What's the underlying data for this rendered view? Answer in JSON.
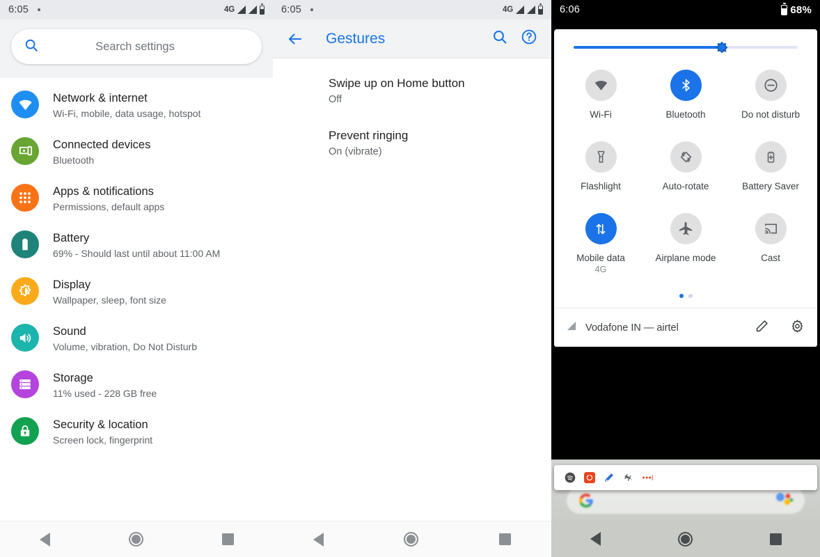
{
  "settings_screen": {
    "status_bar": {
      "time": "6:05",
      "network": "4G"
    },
    "search": {
      "placeholder": "Search settings"
    },
    "items": [
      {
        "title": "Network & internet",
        "subtitle": "Wi-Fi, mobile, data usage, hotspot",
        "icon": "wifi-icon",
        "color": "#1f8ef1"
      },
      {
        "title": "Connected devices",
        "subtitle": "Bluetooth",
        "icon": "connected-devices-icon",
        "color": "#68a532"
      },
      {
        "title": "Apps & notifications",
        "subtitle": "Permissions, default apps",
        "icon": "apps-grid-icon",
        "color": "#f97316"
      },
      {
        "title": "Battery",
        "subtitle": "69% - Should last until about 11:00 AM",
        "icon": "battery-icon",
        "color": "#1e8378"
      },
      {
        "title": "Display",
        "subtitle": "Wallpaper, sleep, font size",
        "icon": "brightness-icon",
        "color": "#fbab1a"
      },
      {
        "title": "Sound",
        "subtitle": "Volume, vibration, Do Not Disturb",
        "icon": "volume-icon",
        "color": "#1cb5ad"
      },
      {
        "title": "Storage",
        "subtitle": "11% used - 228 GB free",
        "icon": "storage-icon",
        "color": "#b444dd"
      },
      {
        "title": "Security & location",
        "subtitle": "Screen lock, fingerprint",
        "icon": "lock-icon",
        "color": "#12a150"
      }
    ]
  },
  "gestures_screen": {
    "status_bar": {
      "time": "6:05",
      "network": "4G"
    },
    "header": {
      "title": "Gestures",
      "accent_color": "#1a73e8"
    },
    "items": [
      {
        "title": "Swipe up on Home button",
        "subtitle": "Off"
      },
      {
        "title": "Prevent ringing",
        "subtitle": "On (vibrate)"
      }
    ]
  },
  "quick_settings": {
    "status_bar": {
      "time": "6:06",
      "battery": "68%"
    },
    "brightness": {
      "percent": 66
    },
    "tiles": [
      {
        "label": "Wi-Fi",
        "sub": "",
        "icon": "wifi-icon",
        "active": false
      },
      {
        "label": "Bluetooth",
        "sub": "",
        "icon": "bluetooth-icon",
        "active": true
      },
      {
        "label": "Do not disturb",
        "sub": "",
        "icon": "do-not-disturb-icon",
        "active": false
      },
      {
        "label": "Flashlight",
        "sub": "",
        "icon": "flashlight-icon",
        "active": false
      },
      {
        "label": "Auto-rotate",
        "sub": "",
        "icon": "auto-rotate-icon",
        "active": false
      },
      {
        "label": "Battery Saver",
        "sub": "",
        "icon": "battery-saver-icon",
        "active": false
      },
      {
        "label": "Mobile data",
        "sub": "4G",
        "icon": "mobile-data-icon",
        "active": true
      },
      {
        "label": "Airplane mode",
        "sub": "",
        "icon": "airplane-icon",
        "active": false
      },
      {
        "label": "Cast",
        "sub": "",
        "icon": "cast-icon",
        "active": false
      }
    ],
    "pages": {
      "count": 2,
      "current": 1
    },
    "footer": {
      "carrier": "Vodafone IN — airtel"
    },
    "accent_color": "#1a73e8"
  }
}
